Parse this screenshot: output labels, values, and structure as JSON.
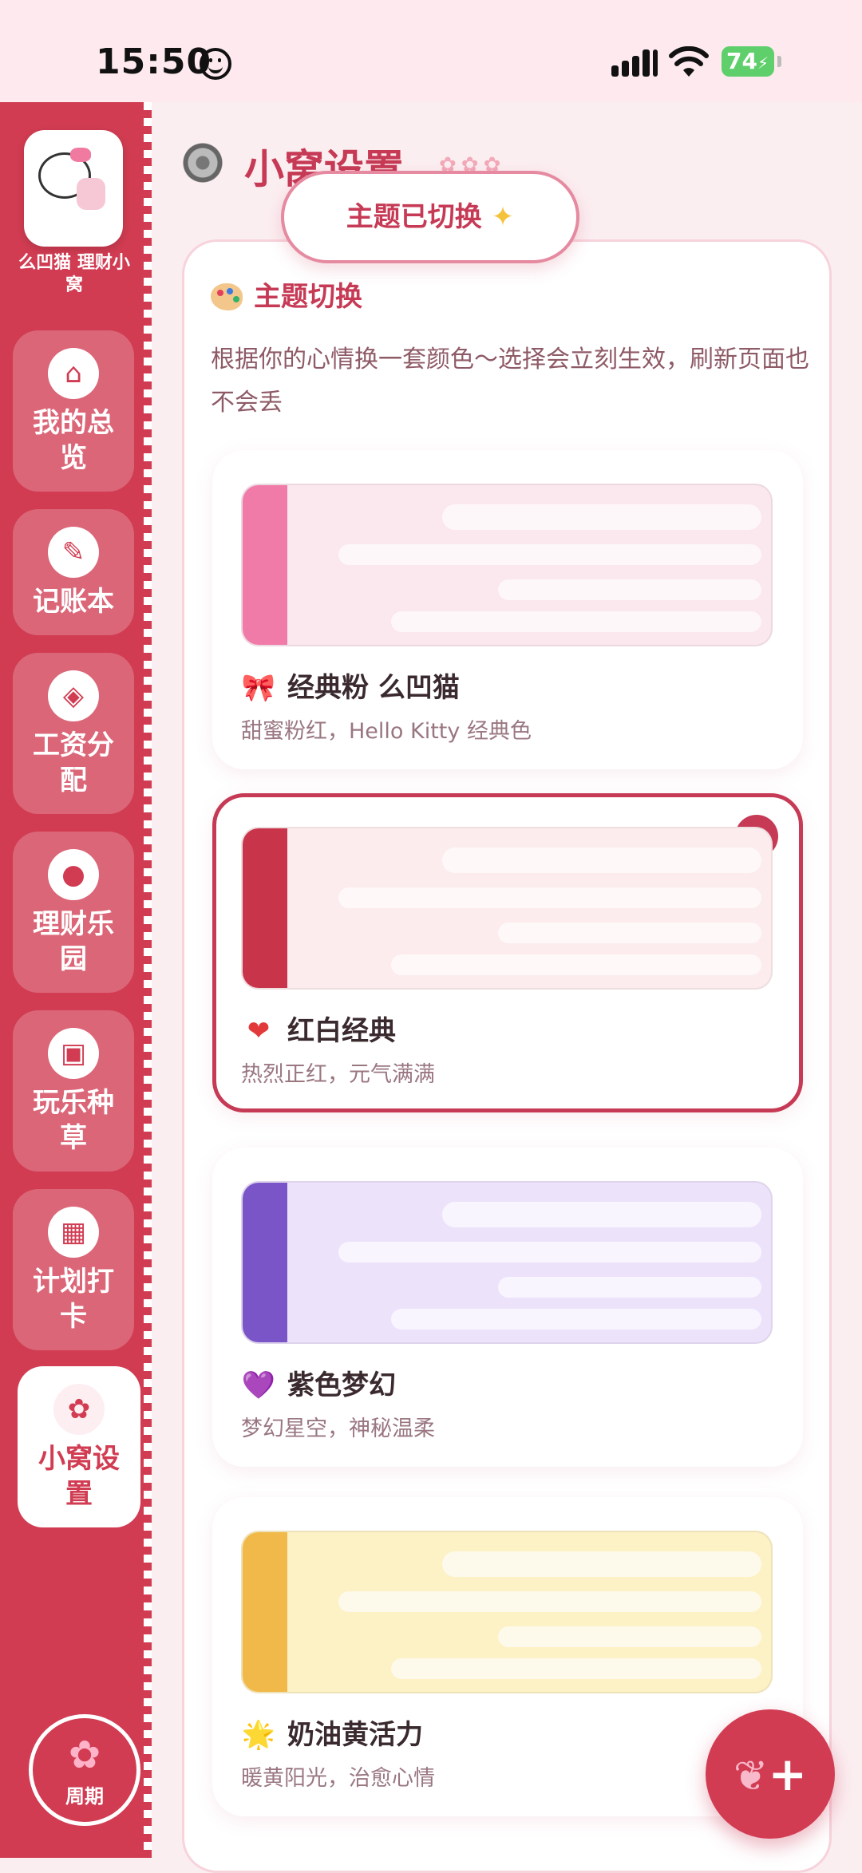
{
  "status_bar": {
    "time": "15:50",
    "battery": "74"
  },
  "sidebar": {
    "app_name": "么凹猫 理财小窝",
    "items": [
      {
        "label": "我的总览",
        "icon": "kitty-house-icon"
      },
      {
        "label": "记账本",
        "icon": "kitty-note-icon"
      },
      {
        "label": "工资分配",
        "icon": "kitty-bag-icon"
      },
      {
        "label": "理财乐园",
        "icon": "kitty-coin-icon"
      },
      {
        "label": "玩乐种草",
        "icon": "kitty-camera-icon"
      },
      {
        "label": "计划打卡",
        "icon": "kitty-calendar-icon"
      },
      {
        "label": "小窝设置",
        "icon": "kitty-settings-icon",
        "active": true
      }
    ],
    "cycle_label": "周期"
  },
  "header": {
    "title": "小窝设置"
  },
  "toast": {
    "text": "主题已切换"
  },
  "theme_section": {
    "title": "主题切换",
    "description": "根据你的心情换一套颜色～选择会立刻生效，刷新页面也不会丢",
    "themes": [
      {
        "name": "经典粉 么凹猫",
        "desc": "甜蜜粉红，Hello Kitty 经典色",
        "emoji": "🎀",
        "stripe_color": "#f07aa8",
        "bg_color": "#fbe7ee",
        "selected": false
      },
      {
        "name": "红白经典",
        "desc": "热烈正红，元气满满",
        "emoji": "❤",
        "stripe_color": "#c8344a",
        "bg_color": "#fcecee",
        "selected": true
      },
      {
        "name": "紫色梦幻",
        "desc": "梦幻星空，神秘温柔",
        "emoji": "💜",
        "stripe_color": "#7a55c8",
        "bg_color": "#ece3fb",
        "selected": false
      },
      {
        "name": "奶油黄活力",
        "desc": "暖黄阳光，治愈心情",
        "emoji": "🌟",
        "stripe_color": "#f0b94a",
        "bg_color": "#fdf1c6",
        "selected": false
      }
    ]
  },
  "colors": {
    "accent": "#d13c52",
    "title": "#c63a55"
  }
}
